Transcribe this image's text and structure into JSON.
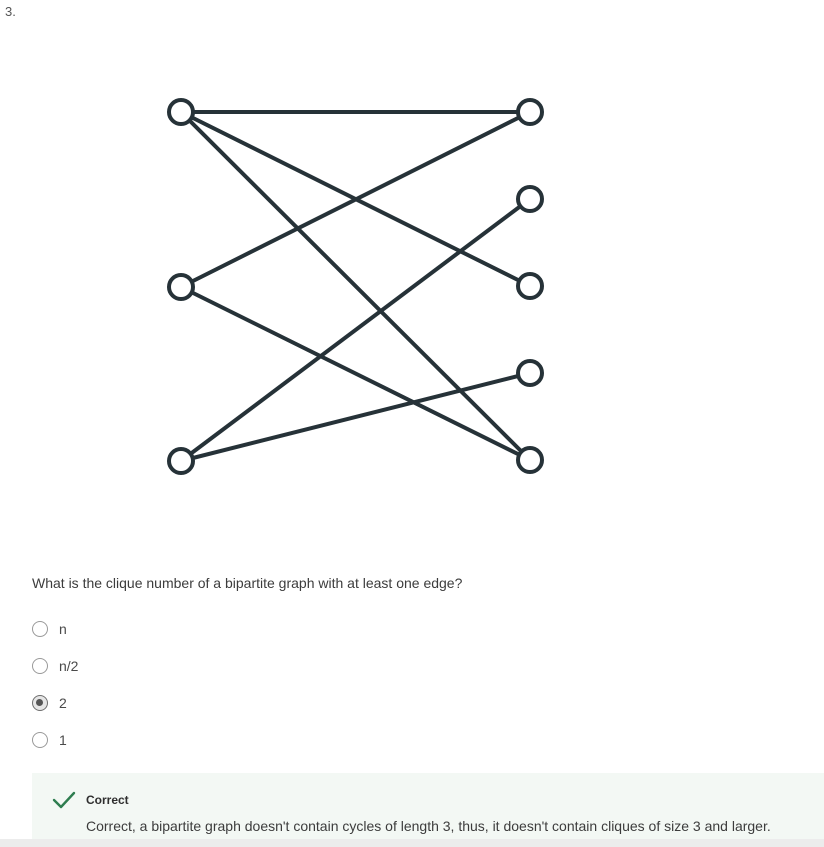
{
  "question": {
    "number": "3.",
    "prompt": "What is the clique number of a bipartite graph with at least one edge?",
    "options": [
      {
        "label": "n",
        "selected": false
      },
      {
        "label": "n/2",
        "selected": false
      },
      {
        "label": "2",
        "selected": true
      },
      {
        "label": "1",
        "selected": false
      }
    ]
  },
  "graph": {
    "left_vertices": [
      "L1",
      "L2",
      "L3"
    ],
    "right_vertices": [
      "R1",
      "R2",
      "R3",
      "R4",
      "R5"
    ],
    "edges": [
      [
        "L1",
        "R1"
      ],
      [
        "L1",
        "R3"
      ],
      [
        "L1",
        "R5"
      ],
      [
        "L2",
        "R1"
      ],
      [
        "L2",
        "R5"
      ],
      [
        "L3",
        "R2"
      ],
      [
        "L3",
        "R4"
      ]
    ],
    "colors": {
      "stroke": "#263238",
      "fill": "#ffffff"
    }
  },
  "feedback": {
    "status": "Correct",
    "message": "Correct, a bipartite graph doesn't contain cycles of length 3, thus, it doesn't contain cliques of size 3 and larger.",
    "icon": "check-icon",
    "color": "#2e7d4f"
  }
}
